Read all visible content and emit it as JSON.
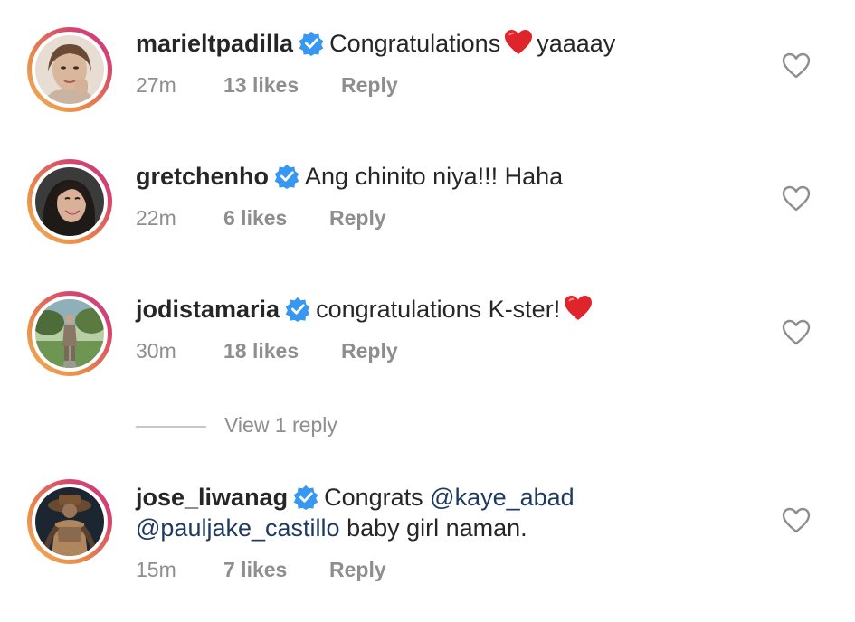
{
  "comments": [
    {
      "username": "marieltpadilla",
      "text_before": "Congratulations",
      "has_heart_inline": true,
      "text_after": "yaaaay",
      "time": "27m",
      "likes": "13 likes",
      "reply": "Reply"
    },
    {
      "username": "gretchenho",
      "text": "Ang chinito niya!!! Haha",
      "time": "22m",
      "likes": "6 likes",
      "reply": "Reply"
    },
    {
      "username": "jodistamaria",
      "text": "congratulations K-ster!",
      "has_heart_end": true,
      "time": "30m",
      "likes": "18 likes",
      "reply": "Reply"
    },
    {
      "username": "jose_liwanag",
      "text_start": "Congrats",
      "mention1": "@kaye_abad",
      "mention2": "@pauljake_castillo",
      "text_end": "baby girl naman.",
      "time": "15m",
      "likes": "7 likes",
      "reply": "Reply"
    }
  ],
  "view_replies": "View 1 reply",
  "colors": {
    "verified_blue": "#3897f0",
    "heart_red": "#e0242b",
    "meta_gray": "#8e8e8e",
    "mention_blue": "#1e3a5f"
  },
  "icons": [
    "verified-badge-icon",
    "heart-outline-icon",
    "red-heart-emoji"
  ]
}
